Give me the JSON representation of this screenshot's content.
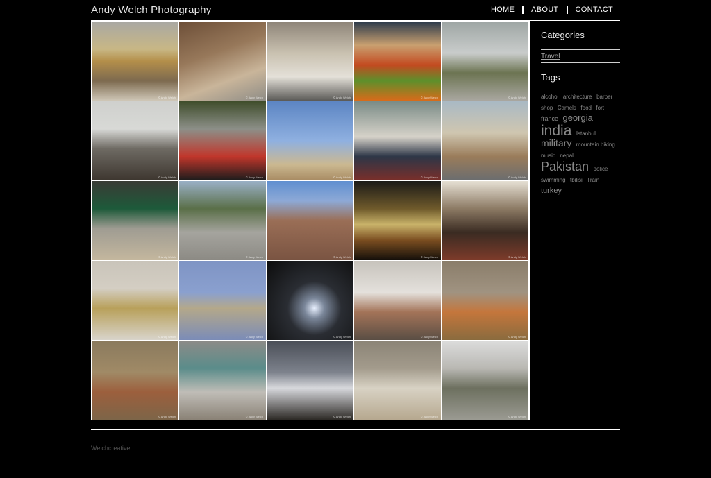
{
  "site": {
    "title": "Andy Welch Photography"
  },
  "nav": {
    "home": "HOME",
    "about": "ABOUT",
    "contact": "CONTACT"
  },
  "sidebar": {
    "categories_heading": "Categories",
    "categories": [
      "Travel"
    ],
    "tags_heading": "Tags",
    "tags": [
      {
        "label": "alcohol",
        "size": 8
      },
      {
        "label": "architecture",
        "size": 8
      },
      {
        "label": "barber shop",
        "size": 8
      },
      {
        "label": "Camels",
        "size": 8
      },
      {
        "label": "food",
        "size": 8
      },
      {
        "label": "fort",
        "size": 8
      },
      {
        "label": "france",
        "size": 9
      },
      {
        "label": "georgia",
        "size": 13
      },
      {
        "label": "india",
        "size": 21
      },
      {
        "label": "Istanbul",
        "size": 8
      },
      {
        "label": "military",
        "size": 14
      },
      {
        "label": "mountain biking",
        "size": 8
      },
      {
        "label": "music",
        "size": 8
      },
      {
        "label": "nepal",
        "size": 8
      },
      {
        "label": "Pakistan",
        "size": 18
      },
      {
        "label": "police",
        "size": 8
      },
      {
        "label": "swimming",
        "size": 8
      },
      {
        "label": "tbilisi",
        "size": 8
      },
      {
        "label": "Train",
        "size": 8
      },
      {
        "label": "turkey",
        "size": 11
      }
    ]
  },
  "gallery": {
    "watermark": "© Andy Welch",
    "photos": [
      {
        "name": "golden-temple-photo",
        "bg": "linear-gradient(180deg,#a9a8a3 0%,#c8b785 35%,#b48f4a 50%,#7d6a4f 75%,#cfc7b7 100%)"
      },
      {
        "name": "mountain-biker-photo",
        "bg": "linear-gradient(160deg,#6d4f38 0%,#97785a 40%,#c9b59a 70%,#8e8c86 100%)"
      },
      {
        "name": "elders-seated-photo",
        "bg": "linear-gradient(180deg,#8e8478 0%,#c9c1b0 40%,#e4e0d8 70%,#5b5a57 100%)"
      },
      {
        "name": "fruit-stall-photo",
        "bg": "linear-gradient(180deg,#2b3a4a 0%,#c9a070 30%,#c34a20 55%,#5e8f2b 75%,#d86b1a 100%)"
      },
      {
        "name": "soldier-camera-photo",
        "bg": "linear-gradient(180deg,#9ea6a4 0%,#c9cccb 40%,#6c7452 65%,#a9a7a0 100%)"
      },
      {
        "name": "beach-crowd-photo",
        "bg": "linear-gradient(180deg,#cfd0cd 0%,#d8d9d6 35%,#6e6a63 60%,#3d362f 100%)"
      },
      {
        "name": "man-with-photo-photo",
        "bg": "linear-gradient(180deg,#3f4d2b 0%,#8c8f88 35%,#c0362b 70%,#1c1c1c 100%)"
      },
      {
        "name": "jumping-boy-photo",
        "bg": "linear-gradient(180deg,#5c85c3 0%,#8fb0e0 50%,#cbb891 80%,#a88b63 100%)"
      },
      {
        "name": "laptop-men-photo",
        "bg": "linear-gradient(180deg,#7a8b86 0%,#d6d2c9 45%,#2d3647 70%,#7a2f2a 100%)"
      },
      {
        "name": "bicycle-man-portrait-photo",
        "bg": "linear-gradient(180deg,#a9b9c4 0%,#cfc6b0 40%,#9a7c5a 70%,#6b6d6f 100%)"
      },
      {
        "name": "street-bicycle-photo",
        "bg": "linear-gradient(180deg,#3a3b35 0%,#1d5a3a 35%,#9f9c92 60%,#c4b79e 100%)"
      },
      {
        "name": "city-square-photo",
        "bg": "linear-gradient(180deg,#9ab0c6 0%,#5a6f48 35%,#a5a49e 65%,#8c8a84 100%)"
      },
      {
        "name": "fort-wall-photo",
        "bg": "linear-gradient(180deg,#5f8fd0 0%,#8da9d6 25%,#9a6e56 50%,#7a5442 100%)"
      },
      {
        "name": "sunset-clouds-photo",
        "bg": "linear-gradient(180deg,#1b1a17 0%,#6f5a2b 35%,#c9b36a 55%,#7a4d20 75%,#140f0a 100%)"
      },
      {
        "name": "drummer-photo",
        "bg": "linear-gradient(180deg,#e6e0d4 0%,#8c7a64 35%,#3a2b22 65%,#7d3b2a 100%)"
      },
      {
        "name": "kids-group-photo",
        "bg": "linear-gradient(180deg,#c9c4ba 0%,#d4cec3 35%,#b8a05a 60%,#d8d4cb 100%)"
      },
      {
        "name": "blue-wall-photo",
        "bg": "linear-gradient(180deg,#7f94c4 0%,#8aa0cf 40%,#b4a88a 60%,#7b8cb7 100%)"
      },
      {
        "name": "light-glow-photo",
        "bg": "radial-gradient(circle at 55% 60%,#e8f0ff 0%,#7a8699 15%,#2a2d33 40%,#0c0c0c 100%)"
      },
      {
        "name": "barber-shop-photo",
        "bg": "linear-gradient(180deg,#c7c3bc 0%,#e4e1dc 40%,#a37358 65%,#5a4e44 100%)"
      },
      {
        "name": "river-bather-photo",
        "bg": "linear-gradient(180deg,#8a7d6a 0%,#a09381 40%,#c4763c 65%,#8a6b3e 100%)"
      },
      {
        "name": "swimming-boy-photo",
        "bg": "linear-gradient(180deg,#8a7a5e 0%,#a08a66 40%,#9c5f3d 65%,#7d6548 100%)"
      },
      {
        "name": "street-men-photo",
        "bg": "linear-gradient(180deg,#8d8b88 0%,#5a8c8a 35%,#c0bdb7 65%,#8a8276 100%)"
      },
      {
        "name": "shore-silhouettes-photo",
        "bg": "linear-gradient(180deg,#4a4e57 0%,#7d828c 40%,#d7d8dc 60%,#2d2a26 100%)"
      },
      {
        "name": "camels-desert-photo",
        "bg": "linear-gradient(180deg,#8b8476 0%,#a39b8c 35%,#d8d2c4 60%,#b6a88f 100%)"
      },
      {
        "name": "armored-vehicle-photo",
        "bg": "linear-gradient(180deg,#dcdcdc 0%,#b9b8b3 35%,#6d705f 60%,#9a9a92 100%)"
      }
    ]
  },
  "footer": {
    "text": "Welchcreative."
  }
}
